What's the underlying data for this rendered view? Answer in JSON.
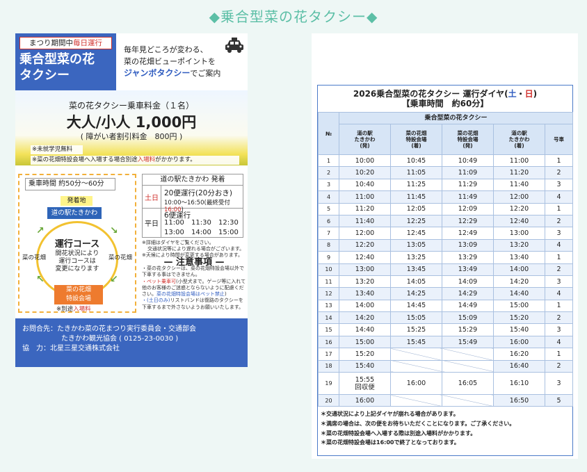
{
  "page_title": "◆乗合型菜の花タクシー◆",
  "flyer": {
    "badge_pre": "まつり期間中",
    "badge_red": "毎日運行",
    "brand_line1": "乗合型菜の花",
    "brand_line2": "タクシー",
    "intro_line1": "毎年見どころが変わる、",
    "intro_line2": "菜の花畑ビューポイントを",
    "intro_blue": "ジャンボタクシー",
    "intro_tail": "でご案内",
    "price_head": "菜の花タクシー乗車料金（１名）",
    "price_main": "大人/小人 1,000円",
    "price_sub": "( 障がい者割引料金　800円 )",
    "note1": "※未就学児無料",
    "note2_pre": "※菜の花畑特設会場へ入場する場合別途",
    "note2_red": "入場料",
    "note2_post": "がかかります。",
    "duration": "乗車時間 約50分～60分",
    "start_label": "発着地",
    "station1": "道の駅たきかわ",
    "course_title": "運行コース",
    "course_desc_1": "開花状況により",
    "course_desc_2": "運行コースは",
    "course_desc_3": "変更になります",
    "flower_left": "菜の花畑",
    "flower_right": "菜の花畑",
    "station2_1": "菜の花畑",
    "station2_2": "特設会場",
    "fee_pre": "※別途",
    "fee_red": "入場料",
    "sched_head": "道の駅たきかわ 発着",
    "weekend_label": "土日",
    "weekend_line1": "20便運行(20分おき)",
    "weekend_line2": "10:00～16:50",
    "weekend_line2_small": "(最終受付",
    "weekend_last": "16:00",
    "weekend_close": ")",
    "weekday_label": "平日",
    "weekday_line1": "6便運行",
    "weekday_times": [
      "11:00",
      "11:30",
      "12:30",
      "13:00",
      "14:00",
      "15:00"
    ],
    "small_note1": "※詳細はダイヤをご覧ください。",
    "small_note2": "交通状況等により遅れる場合がございます。",
    "small_note3": "※天候により時間が変更する場合があります。",
    "caution_title": "— 注意事項 —",
    "caution1": "・菜の花タクシーは、菜の花畑特設会場以外で下車する事はできません。",
    "caution2_red": "・ペット乗車可",
    "caution2": "(小型犬まで。ゲージ等に入れて他のお客様のご迷惑とならないように配慮ください。",
    "caution2_blue": "菜の花畑特設会場はペット禁止",
    "caution2_end": ")",
    "caution3_blue": "・(土日のみ)",
    "caution3": "リストバンドは復路のタクシーを下車するまで外さないようお願いいたします。",
    "footer_line1": "お問合先：たきかわ菜の花まつり実行委員会・交通部会",
    "footer_line2": "たきかわ観光協会 ( 0125-23-0030 )",
    "footer_line3": "協　力：北星三星交通株式会社"
  },
  "timetable": {
    "title_pre": "2026乗合型菜の花タクシー 運行ダイヤ(",
    "title_sat": "土",
    "title_dot": "・",
    "title_sun": "日",
    "title_post": ")",
    "subtitle": "【乗車時間　約60分】",
    "group_header": "乗合型菜の花タクシー",
    "col_no": "№",
    "col1": "道の駅\nたきかわ\n(発)",
    "col2": "菜の花畑\n特設会場\n(着)",
    "col3": "菜の花畑\n特設会場\n(発)",
    "col4": "道の駅\nたきかわ\n(着)",
    "col5": "号車",
    "rows": [
      [
        "1",
        "10:00",
        "10:45",
        "10:49",
        "11:00",
        "1"
      ],
      [
        "2",
        "10:20",
        "11:05",
        "11:09",
        "11:20",
        "2"
      ],
      [
        "3",
        "10:40",
        "11:25",
        "11:29",
        "11:40",
        "3"
      ],
      [
        "4",
        "11:00",
        "11:45",
        "11:49",
        "12:00",
        "4"
      ],
      [
        "5",
        "11:20",
        "12:05",
        "12:09",
        "12:20",
        "1"
      ],
      [
        "6",
        "11:40",
        "12:25",
        "12:29",
        "12:40",
        "2"
      ],
      [
        "7",
        "12:00",
        "12:45",
        "12:49",
        "13:00",
        "3"
      ],
      [
        "8",
        "12:20",
        "13:05",
        "13:09",
        "13:20",
        "4"
      ],
      [
        "9",
        "12:40",
        "13:25",
        "13:29",
        "13:40",
        "1"
      ],
      [
        "10",
        "13:00",
        "13:45",
        "13:49",
        "14:00",
        "2"
      ],
      [
        "11",
        "13:20",
        "14:05",
        "14:09",
        "14:20",
        "3"
      ],
      [
        "12",
        "13:40",
        "14:25",
        "14:29",
        "14:40",
        "4"
      ],
      [
        "13",
        "14:00",
        "14:45",
        "14:49",
        "15:00",
        "1"
      ],
      [
        "14",
        "14:20",
        "15:05",
        "15:09",
        "15:20",
        "2"
      ],
      [
        "15",
        "14:40",
        "15:25",
        "15:29",
        "15:40",
        "3"
      ],
      [
        "16",
        "15:00",
        "15:45",
        "15:49",
        "16:00",
        "4"
      ],
      [
        "17",
        "15:20",
        "",
        "",
        "16:20",
        "1"
      ],
      [
        "18",
        "15:40",
        "",
        "",
        "16:40",
        "2"
      ],
      [
        "19",
        "15:55\n回収便",
        "16:00",
        "16:05",
        "16:10",
        "3"
      ],
      [
        "20",
        "16:00",
        "",
        "",
        "16:50",
        "5"
      ]
    ],
    "notes": [
      "＊交通状況により上記ダイヤが崩れる場合があります。",
      "＊満席の場合は、次の便をお待ちいただくことになります。ご了承ください。",
      "＊菜の花畑特設会場へ入場する際は別途入場料がかかります。",
      "＊菜の花畑特設会場は16:00で終了となっております。"
    ]
  }
}
